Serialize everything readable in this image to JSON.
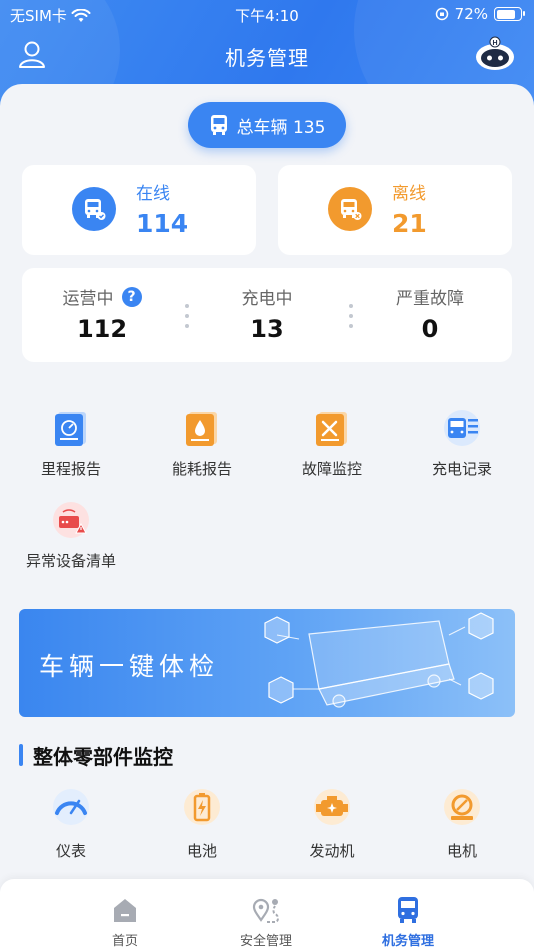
{
  "status_bar": {
    "carrier": "无SIM卡",
    "time": "下午4:10",
    "battery": "72%"
  },
  "header": {
    "title": "机务管理",
    "left_icon": "user-icon",
    "right_icon": "robot-assistant-icon"
  },
  "total": {
    "label": "总车辆 135"
  },
  "online": {
    "label": "在线",
    "value": "114",
    "color": "#3a85f2"
  },
  "offline": {
    "label": "离线",
    "value": "21",
    "color": "#f29a2e"
  },
  "stats": [
    {
      "label": "运营中",
      "value": "112",
      "has_help": true,
      "help": "?"
    },
    {
      "label": "充电中",
      "value": "13"
    },
    {
      "label": "严重故障",
      "value": "0"
    }
  ],
  "quick_menu": [
    {
      "label": "里程报告",
      "icon": "mileage-report-icon"
    },
    {
      "label": "能耗报告",
      "icon": "energy-report-icon"
    },
    {
      "label": "故障监控",
      "icon": "fault-monitor-icon"
    },
    {
      "label": "充电记录",
      "icon": "charging-record-icon"
    },
    {
      "label": "异常设备清单",
      "icon": "abnormal-device-icon"
    }
  ],
  "banner": {
    "title": "车辆一键体检"
  },
  "parts_section": {
    "title": "整体零部件监控",
    "items": [
      {
        "label": "仪表",
        "icon": "gauge-icon"
      },
      {
        "label": "电池",
        "icon": "battery-icon"
      },
      {
        "label": "发动机",
        "icon": "engine-icon"
      },
      {
        "label": "电机",
        "icon": "motor-icon"
      }
    ]
  },
  "tabs": [
    {
      "label": "首页",
      "icon": "home-icon",
      "active": false
    },
    {
      "label": "安全管理",
      "icon": "route-icon",
      "active": false
    },
    {
      "label": "机务管理",
      "icon": "bus-icon",
      "active": true
    }
  ],
  "colors": {
    "primary": "#3a85f2",
    "offline": "#f29a2e",
    "danger": "#e84b4b"
  }
}
